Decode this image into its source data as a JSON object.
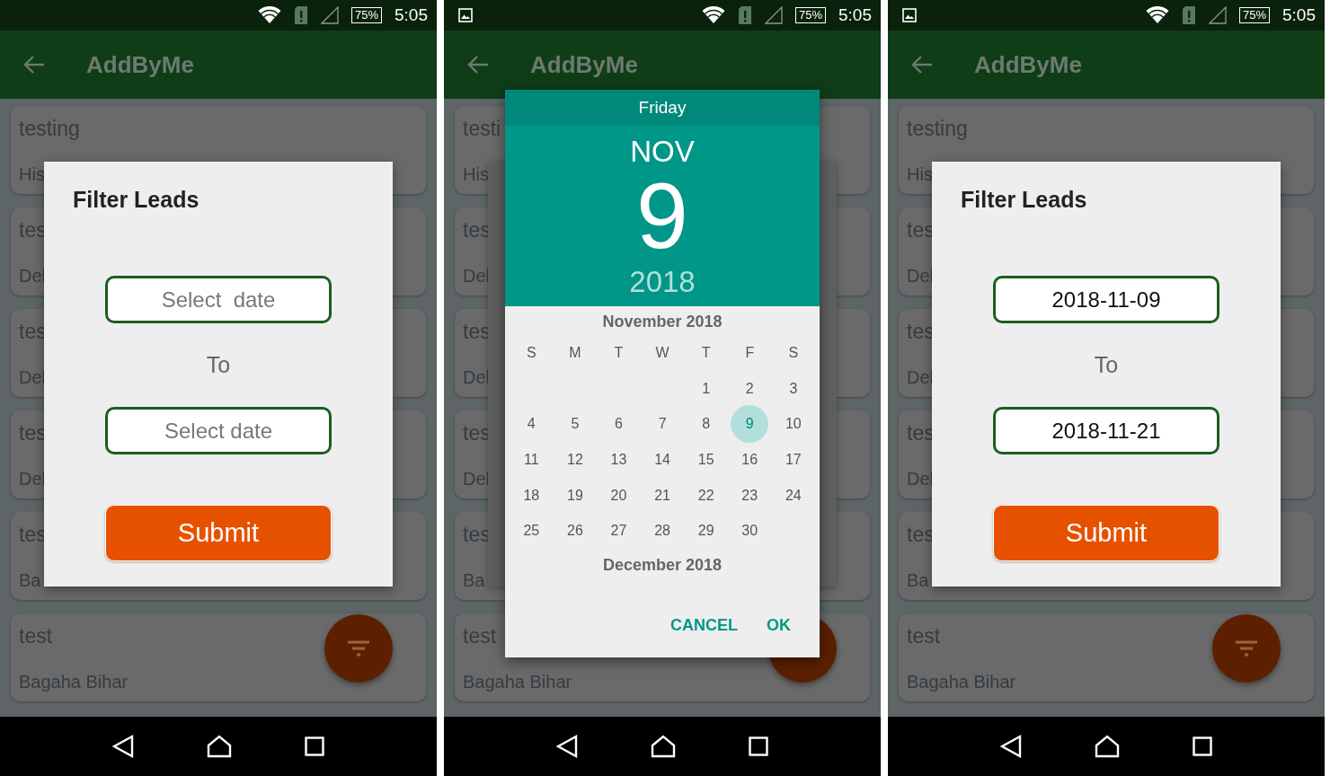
{
  "phones": [
    {
      "status_bar": {
        "image_icon": false,
        "battery": "75%",
        "time": "5:05"
      },
      "app_bar": {
        "title": "AddByMe"
      },
      "cards": [
        {
          "title": "testing",
          "subtitle": "His"
        },
        {
          "title": "tes",
          "subtitle": "Del"
        },
        {
          "title": "tes",
          "subtitle": "Del"
        },
        {
          "title": "tes",
          "subtitle": "Del"
        },
        {
          "title": "tes",
          "subtitle": "Ba"
        },
        {
          "title": "test",
          "subtitle": "Bagaha Bihar"
        }
      ],
      "dialog": {
        "kind": "filter",
        "title": "Filter Leads",
        "from": {
          "placeholder": "Select  date"
        },
        "to_label": "To",
        "to": {
          "placeholder": "Select date"
        },
        "submit": "Submit"
      }
    },
    {
      "status_bar": {
        "image_icon": true,
        "battery": "75%",
        "time": "5:05"
      },
      "app_bar": {
        "title": "AddByMe"
      },
      "cards": [
        {
          "title": "testi",
          "subtitle": "His"
        },
        {
          "title": "tes",
          "subtitle": "Del"
        },
        {
          "title": "tes",
          "subtitle": "Del"
        },
        {
          "title": "tes",
          "subtitle": "Del"
        },
        {
          "title": "tes",
          "subtitle": "Ba"
        },
        {
          "title": "test",
          "subtitle": "Bagaha Bihar"
        }
      ],
      "dialog": {
        "kind": "date_picker",
        "weekday": "Friday",
        "month": "NOV",
        "day": "9",
        "year": "2018",
        "month_title": "November 2018",
        "weekday_labels": [
          "S",
          "M",
          "T",
          "W",
          "T",
          "F",
          "S"
        ],
        "weeks": [
          {
            "days": [
              {
                "label": "1",
                "selected": false
              },
              {
                "label": "2",
                "selected": false
              },
              {
                "label": "3",
                "selected": false
              }
            ]
          },
          {
            "days": [
              {
                "label": "4",
                "selected": false
              },
              {
                "label": "5",
                "selected": false
              },
              {
                "label": "6",
                "selected": false
              },
              {
                "label": "7",
                "selected": false
              },
              {
                "label": "8",
                "selected": false
              },
              {
                "label": "9",
                "selected": true
              },
              {
                "label": "10",
                "selected": false
              }
            ]
          },
          {
            "days": [
              {
                "label": "11",
                "selected": false
              },
              {
                "label": "12",
                "selected": false
              },
              {
                "label": "13",
                "selected": false
              },
              {
                "label": "14",
                "selected": false
              },
              {
                "label": "15",
                "selected": false
              },
              {
                "label": "16",
                "selected": false
              },
              {
                "label": "17",
                "selected": false
              }
            ]
          },
          {
            "days": [
              {
                "label": "18",
                "selected": false
              },
              {
                "label": "19",
                "selected": false
              },
              {
                "label": "20",
                "selected": false
              },
              {
                "label": "21",
                "selected": false
              },
              {
                "label": "22",
                "selected": false
              },
              {
                "label": "23",
                "selected": false
              },
              {
                "label": "24",
                "selected": false
              }
            ]
          },
          {
            "days": [
              {
                "label": "25",
                "selected": false
              },
              {
                "label": "26",
                "selected": false
              },
              {
                "label": "27",
                "selected": false
              },
              {
                "label": "28",
                "selected": false
              },
              {
                "label": "29",
                "selected": false
              },
              {
                "label": "30",
                "selected": false
              }
            ]
          }
        ],
        "next_month_title": "December 2018",
        "buttons": [
          "CANCEL",
          "OK"
        ]
      }
    },
    {
      "status_bar": {
        "image_icon": true,
        "battery": "75%",
        "time": "5:05"
      },
      "app_bar": {
        "title": "AddByMe"
      },
      "cards": [
        {
          "title": "testing",
          "subtitle": "His"
        },
        {
          "title": "tes",
          "subtitle": "Del"
        },
        {
          "title": "tes",
          "subtitle": "Del"
        },
        {
          "title": "tes",
          "subtitle": "Del"
        },
        {
          "title": "tes",
          "subtitle": "Ba"
        },
        {
          "title": "test",
          "subtitle": "Bagaha Bihar"
        }
      ],
      "dialog": {
        "kind": "filter",
        "title": "Filter Leads",
        "from": {
          "value": "2018-11-09"
        },
        "to_label": "To",
        "to": {
          "value": "2018-11-21"
        },
        "submit": "Submit"
      }
    }
  ]
}
